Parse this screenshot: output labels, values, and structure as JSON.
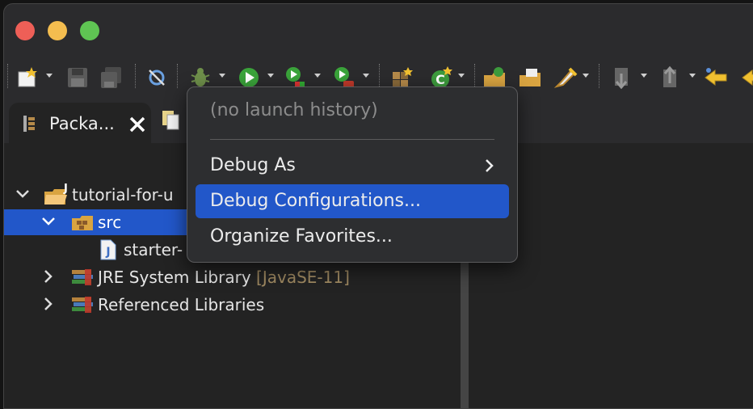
{
  "window": {
    "controls": [
      "close",
      "minimize",
      "zoom"
    ]
  },
  "toolbar": {
    "icons": [
      "new-wizard-icon",
      "save-icon",
      "save-all-icon",
      "skip-breakpoints-icon",
      "debug-icon",
      "run-icon",
      "coverage-icon",
      "external-tools-icon",
      "new-java-package-icon",
      "new-java-class-icon",
      "open-type-icon",
      "open-task-icon",
      "search-icon",
      "next-annotation-icon",
      "previous-annotation-icon",
      "back-icon",
      "forward-icon"
    ]
  },
  "package_explorer": {
    "tab_label": "Packa...",
    "tree": [
      {
        "label": "tutorial-for-u",
        "icon": "java-project-icon",
        "expanded": true
      },
      {
        "label": "src",
        "icon": "source-folder-icon",
        "expanded": true,
        "selected": true
      },
      {
        "label": "starter-",
        "icon": "java-file-icon"
      },
      {
        "label": "JRE System Library",
        "decoration": "[JavaSE-11]",
        "icon": "library-icon",
        "expanded": false
      },
      {
        "label": "Referenced Libraries",
        "icon": "library-icon",
        "expanded": false
      }
    ]
  },
  "debug_menu": {
    "history": "(no launch history)",
    "items": [
      {
        "label": "Debug As",
        "has_submenu": true
      },
      {
        "label": "Debug Configurations...",
        "highlighted": true
      },
      {
        "label": "Organize Favorites..."
      }
    ]
  },
  "colors": {
    "selection": "#2257c9",
    "background": "#232323",
    "menu_bg": "#2d2e30",
    "decoration": "#a08a62"
  }
}
